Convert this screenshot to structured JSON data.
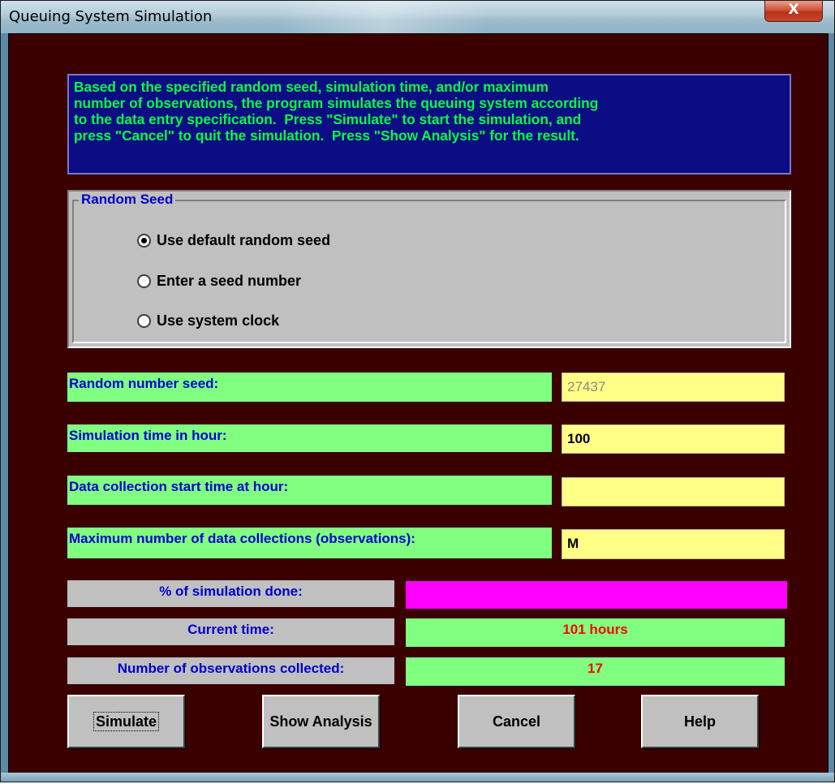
{
  "window": {
    "title": "Queuing System Simulation",
    "close_label": "X"
  },
  "info": {
    "text": "Based on the specified random seed, simulation time, and/or maximum\nnumber of observations, the program simulates the queuing system according\nto the data entry specification.  Press \"Simulate\" to start the simulation, and\npress \"Cancel\" to quit the simulation.  Press \"Show Analysis\" for the result."
  },
  "random_seed": {
    "legend": "Random Seed",
    "options": [
      {
        "label": "Use default random seed",
        "selected": true
      },
      {
        "label": "Enter a seed number",
        "selected": false
      },
      {
        "label": "Use system clock",
        "selected": false
      }
    ]
  },
  "fields": {
    "seed_label": "Random number seed:",
    "seed_value": "27437",
    "sim_time_label": "Simulation time in hour:",
    "sim_time_value": "100",
    "start_time_label": "Data collection start time at hour:",
    "start_time_value": "",
    "max_obs_label": "Maximum number of data collections (observations):",
    "max_obs_value": "M"
  },
  "status": {
    "progress_label": "% of simulation done:",
    "progress_value": 1.0,
    "current_time_label": "Current time:",
    "current_time_value": "101 hours",
    "observations_label": "Number of observations collected:",
    "observations_value": "17"
  },
  "buttons": {
    "simulate": "Simulate",
    "show_analysis": "Show Analysis",
    "cancel": "Cancel",
    "help": "Help"
  },
  "colors": {
    "background": "#3a0000",
    "info_bg": "#0c0c84",
    "info_text": "#00ff44",
    "label_bg": "#80ff80",
    "label_text": "#0000d0",
    "input_bg": "#ffff88",
    "progress_fill": "#ff00ff",
    "status_text": "#ff0000"
  }
}
